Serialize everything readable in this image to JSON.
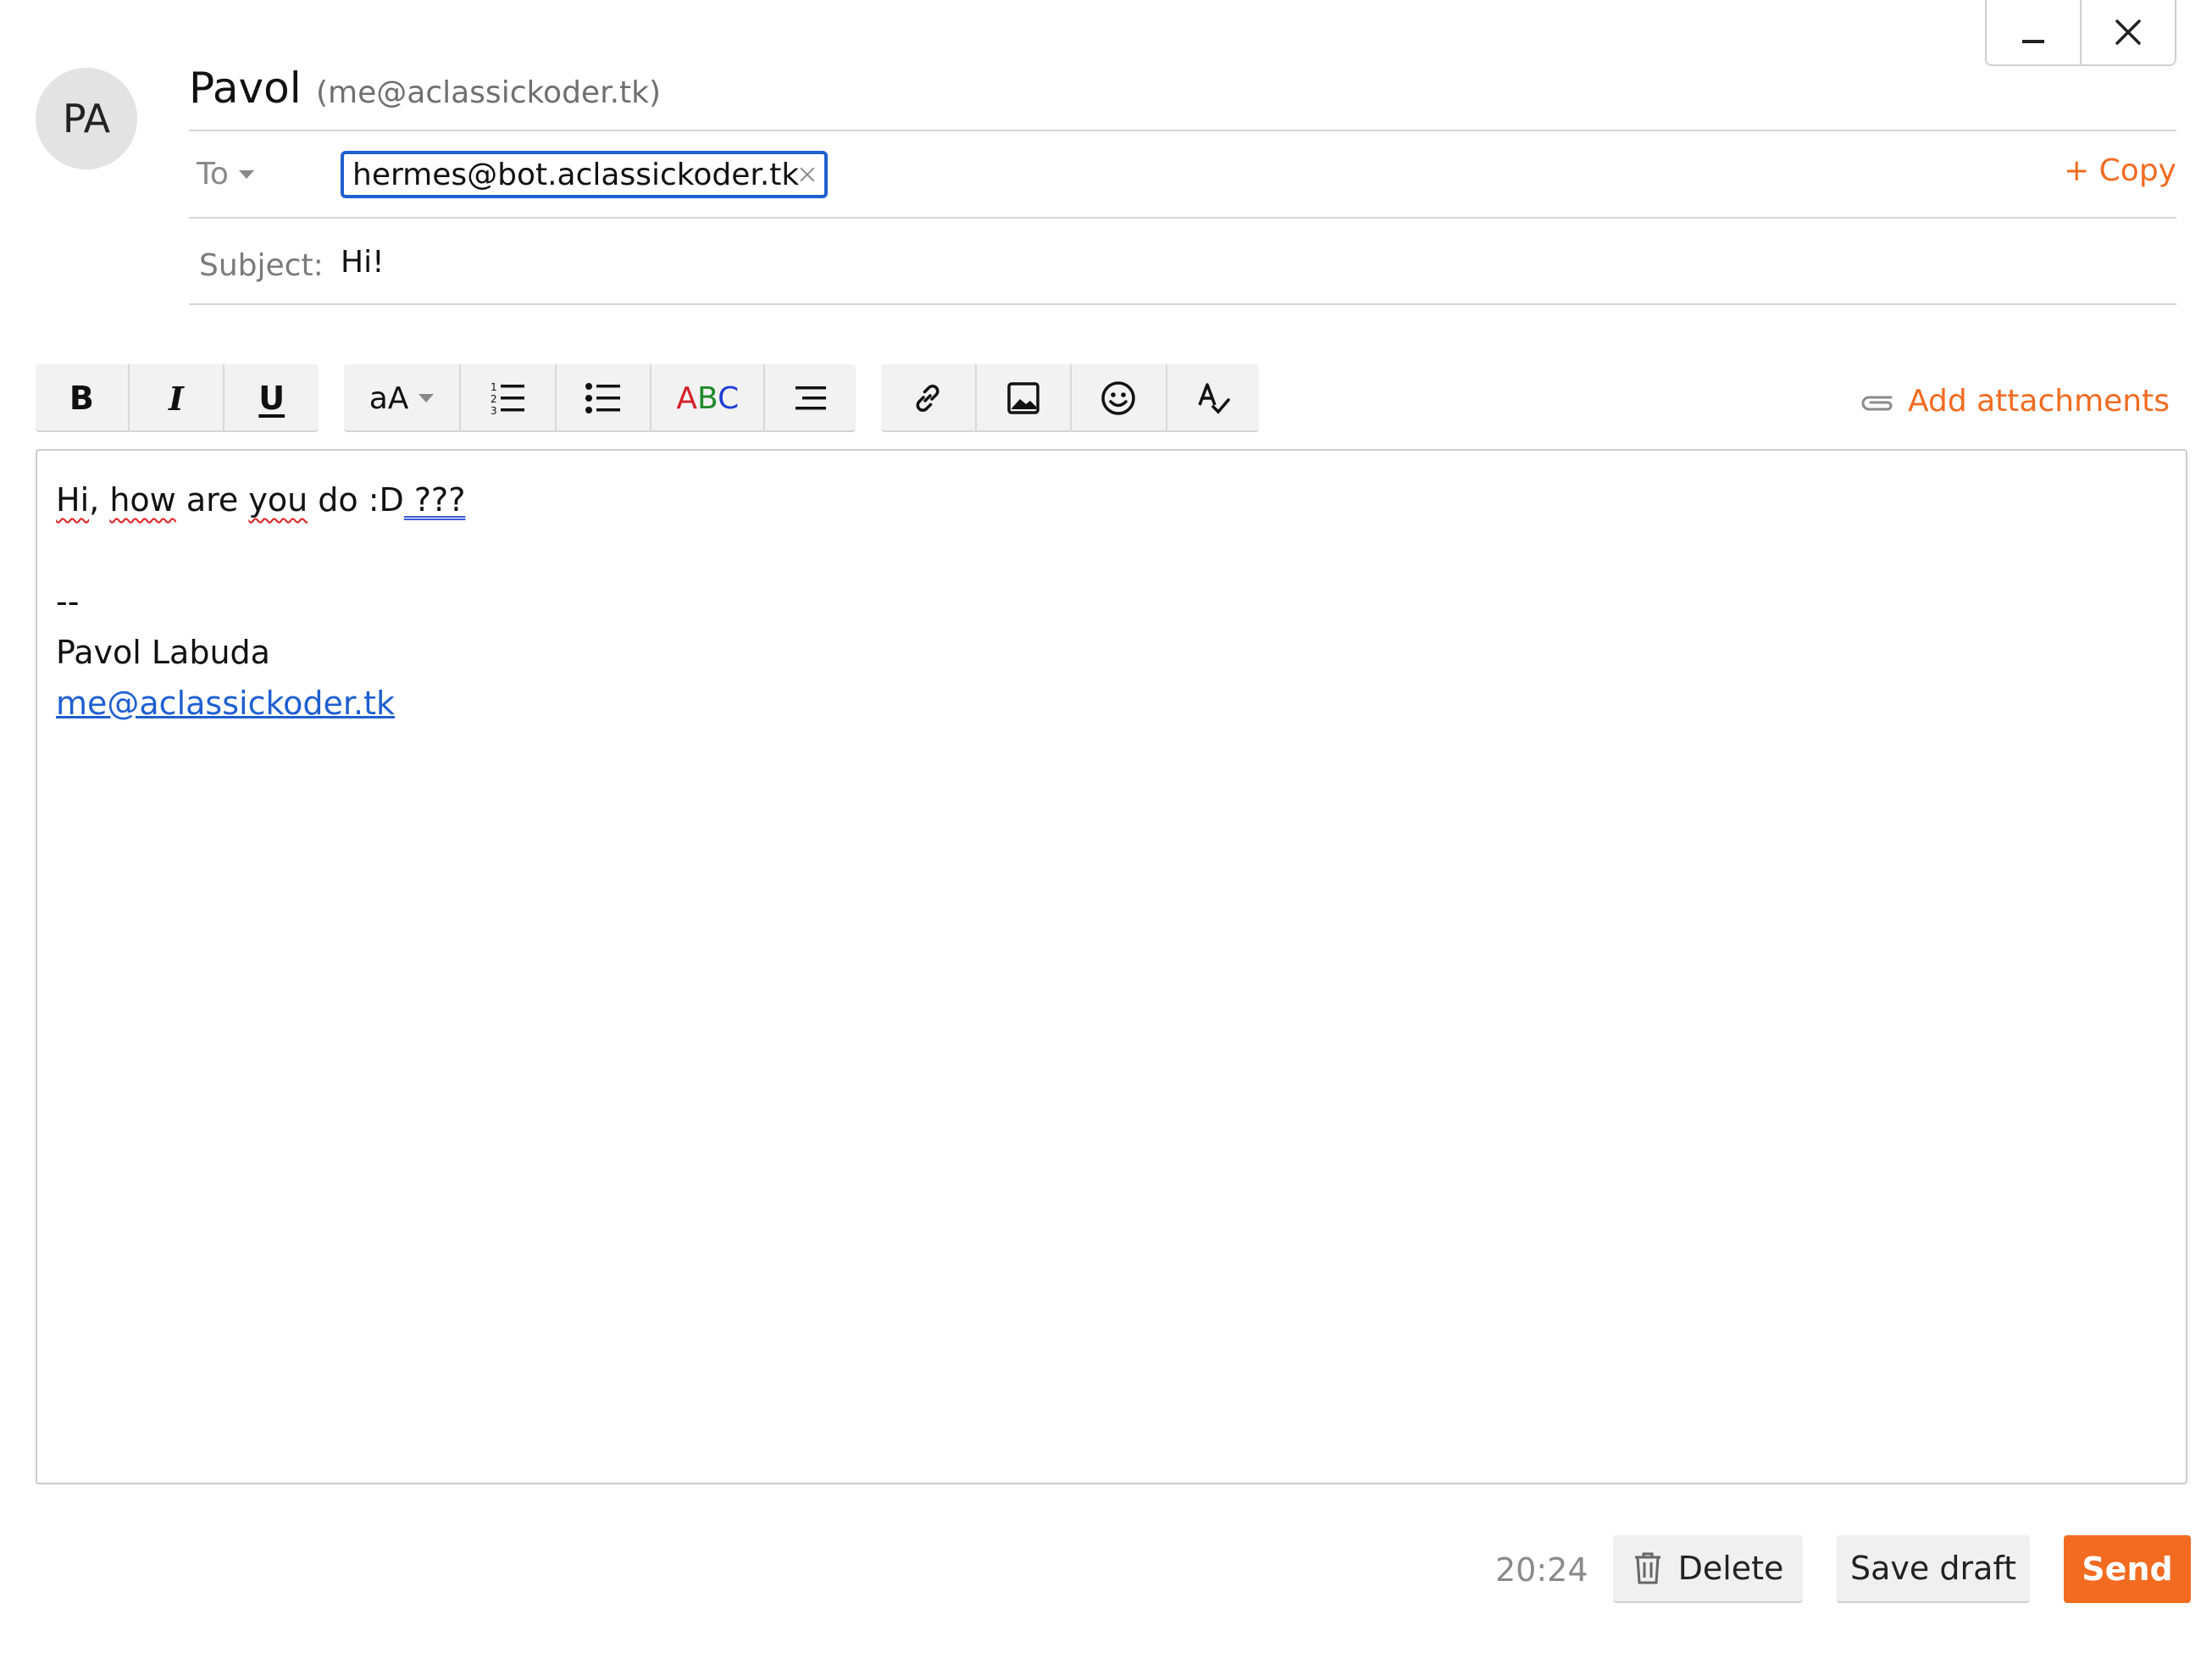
{
  "sender": {
    "initials": "PA",
    "name": "Pavol",
    "email": "(me@aclassickoder.tk)"
  },
  "to": {
    "label": "To",
    "recipient": "hermes@bot.aclassickoder.tk",
    "copy_label": "+ Copy"
  },
  "subject": {
    "label": "Subject:",
    "value": "Hi!"
  },
  "toolbar": {
    "bold": "B",
    "italic": "I",
    "underline": "U",
    "font_size": "aA",
    "spellcheck_a": "A",
    "spellcheck_b": "B",
    "spellcheck_c": "C",
    "add_attachments": "Add attachments"
  },
  "body": {
    "w1": "Hi",
    "w2": ", ",
    "w3": "how",
    "w4": " are ",
    "w5": "you",
    "w6": " do :D",
    "w7": " ???",
    "sig_sep": "--",
    "sig_name": "Pavol Labuda",
    "sig_email": "me@aclassickoder.tk"
  },
  "footer": {
    "time": "20:24",
    "delete_label": "Delete",
    "save_draft_label": "Save draft",
    "send_label": "Send"
  },
  "colors": {
    "accent": "#f26b21",
    "link": "#1f5fd1"
  }
}
